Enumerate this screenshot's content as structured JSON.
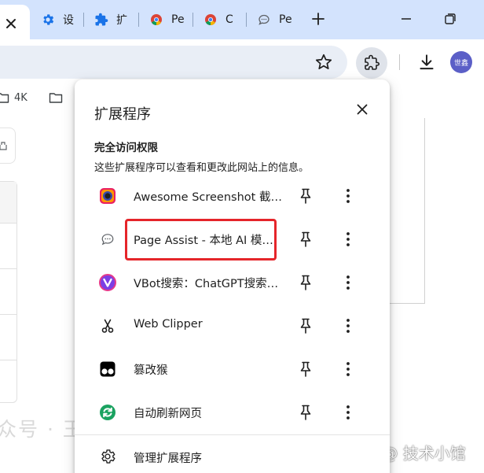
{
  "tabs": [
    {
      "title": "设",
      "icon": "gear-icon"
    },
    {
      "title": "扩",
      "icon": "puzzle-icon"
    },
    {
      "title": "Pe",
      "icon": "chrome-icon"
    },
    {
      "title": "C",
      "icon": "chrome-icon"
    },
    {
      "title": "Pe",
      "icon": "chat-icon"
    }
  ],
  "bookmarks": [
    {
      "label": "4K"
    },
    {
      "label": ""
    }
  ],
  "profile": {
    "initials": "世鑫"
  },
  "popup": {
    "title": "扩展程序",
    "section_title": "完全访问权限",
    "section_desc": "这些扩展程序可以查看和更改此网站上的信息。",
    "extensions": [
      {
        "name": "Awesome Screenshot 截屏与录屏",
        "icon": "camera-icon",
        "color": "#e91e63"
      },
      {
        "name": "Page Assist - 本地 AI 模型的 Web UI",
        "icon": "chat-bubble-icon",
        "color": "#5f6368"
      },
      {
        "name": "VBot搜索：ChatGPT搜索助手",
        "icon": "vbot-icon",
        "color": "#7b3fe4"
      },
      {
        "name": "Web Clipper",
        "icon": "scissors-icon",
        "color": "#1f1f1f"
      },
      {
        "name": "篡改猴",
        "icon": "tampermonkey-icon",
        "color": "#000000"
      },
      {
        "name": "自动刷新网页",
        "icon": "refresh-icon",
        "color": "#1aa260"
      }
    ],
    "manage_label": "管理扩展程序"
  },
  "page": {
    "watermark_left": "众号 · 王",
    "watermark_right": "掘金技术社区 @ 技术小馆"
  },
  "colors": {
    "tabstrip": "#d3e3fd",
    "highlight": "#e5252a",
    "avatar": "#5b5fc7"
  }
}
